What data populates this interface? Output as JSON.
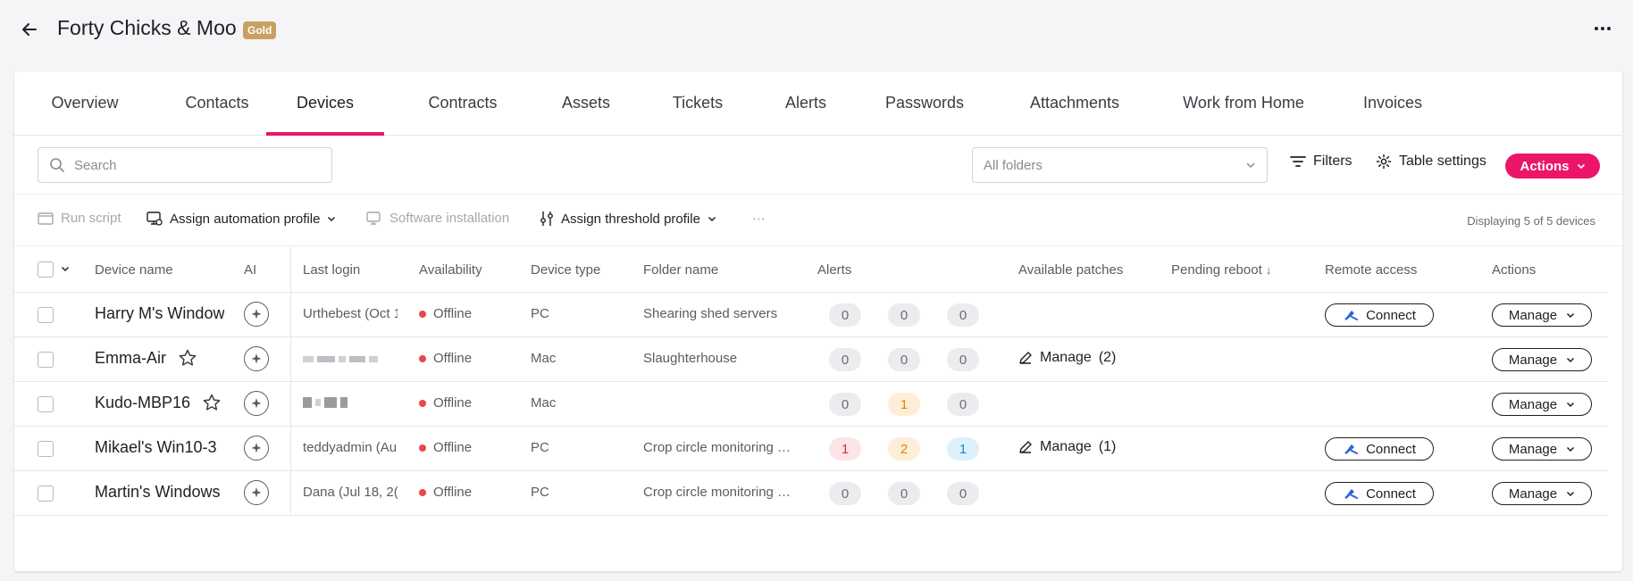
{
  "header": {
    "title": "Forty Chicks & Moo",
    "badge": "Gold"
  },
  "tabs": [
    {
      "label": "Overview"
    },
    {
      "label": "Contacts"
    },
    {
      "label": "Devices"
    },
    {
      "label": "Contracts"
    },
    {
      "label": "Assets"
    },
    {
      "label": "Tickets"
    },
    {
      "label": "Alerts"
    },
    {
      "label": "Passwords"
    },
    {
      "label": "Attachments"
    },
    {
      "label": "Work from Home"
    },
    {
      "label": "Invoices"
    }
  ],
  "toolbar": {
    "search_placeholder": "Search",
    "folders_value": "All folders",
    "filters": "Filters",
    "table_settings": "Table settings",
    "actions": "Actions"
  },
  "bulk": {
    "run_script": "Run script",
    "assign_automation": "Assign automation profile",
    "software_installation": "Software installation",
    "assign_threshold": "Assign threshold profile",
    "more": "⋯",
    "displaying": "Displaying 5 of 5 devices"
  },
  "columns": {
    "device_name": "Device name",
    "ai": "AI",
    "last_login": "Last login",
    "availability": "Availability",
    "device_type": "Device type",
    "folder_name": "Folder name",
    "alerts": "Alerts",
    "available_patches": "Available patches",
    "pending_reboot": "Pending reboot",
    "pending_reboot_sort": "↓",
    "remote_access": "Remote access",
    "actions": "Actions"
  },
  "rows": [
    {
      "name": "Harry M's Window",
      "last_login": "Urthebest (Oct 1",
      "availability": "Offline",
      "type": "PC",
      "folder": "Shearing shed servers",
      "alerts": [
        "0",
        "0",
        "0"
      ],
      "patches_label": "",
      "patches_count": "",
      "connect": "Connect",
      "manage": "Manage"
    },
    {
      "name": "Emma-Air",
      "last_login": "",
      "availability": "Offline",
      "type": "Mac",
      "folder": "Slaughterhouse",
      "alerts": [
        "0",
        "0",
        "0"
      ],
      "patches_label": "Manage",
      "patches_count": "(2)",
      "connect": "",
      "manage": "Manage"
    },
    {
      "name": "Kudo-MBP16",
      "last_login": "",
      "availability": "Offline",
      "type": "Mac",
      "folder": "",
      "alerts": [
        "0",
        "1",
        "0"
      ],
      "patches_label": "",
      "patches_count": "",
      "connect": "",
      "manage": "Manage"
    },
    {
      "name": "Mikael's Win10-3",
      "last_login": "teddyadmin (Au",
      "availability": "Offline",
      "type": "PC",
      "folder": "Crop circle monitoring …",
      "alerts": [
        "1",
        "2",
        "1"
      ],
      "patches_label": "Manage",
      "patches_count": "(1)",
      "connect": "Connect",
      "manage": "Manage"
    },
    {
      "name": "Martin's Windows",
      "last_login": "Dana (Jul 18, 2(",
      "availability": "Offline",
      "type": "PC",
      "folder": "Crop circle monitoring …",
      "alerts": [
        "0",
        "0",
        "0"
      ],
      "patches_label": "",
      "patches_count": "",
      "connect": "Connect",
      "manage": "Manage"
    }
  ],
  "colors": {
    "accent": "#ec1569",
    "offline": "#e5484d",
    "badge_gold": "#c9a062"
  },
  "icons": {
    "back": "arrow-left-icon",
    "kebab": "more-horizontal-icon",
    "search": "search-icon",
    "filter": "filter-icon",
    "settings": "gear-icon",
    "ai": "sparkle-icon",
    "star": "star-icon",
    "patch": "pencil-icon",
    "remote": "remote-access-icon"
  }
}
